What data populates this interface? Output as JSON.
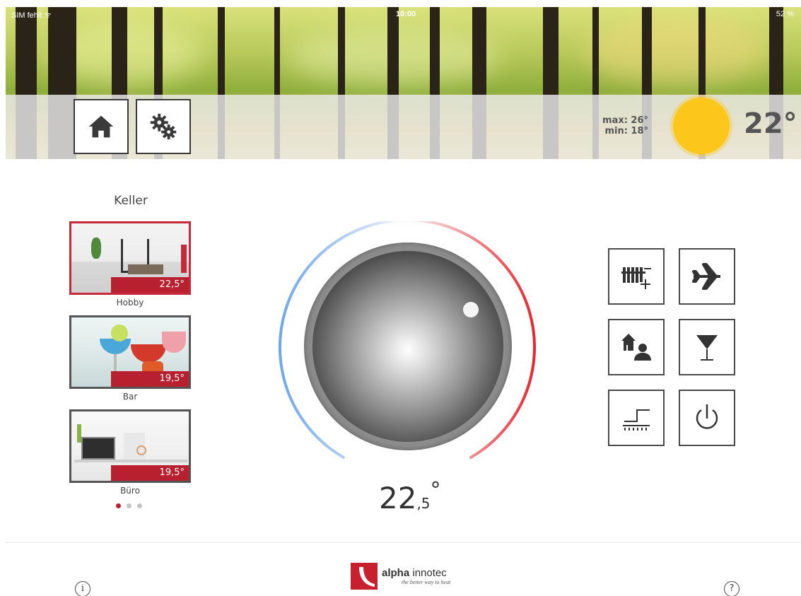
{
  "statusbar": {
    "carrier": "SIM fehlt ᯤ",
    "clock": "10:00",
    "battery": "52 %"
  },
  "header": {
    "home_icon": "home-icon",
    "settings_icon": "gears-icon",
    "weather": {
      "max": "max: 26°",
      "min": "min: 18°",
      "icon": "sun-icon",
      "outside_temp": "22°",
      "sun_color": "#fcc71a"
    }
  },
  "rooms": {
    "floor": "Keller",
    "items": [
      {
        "name": "Hobby",
        "temp": "22,5°",
        "active": true
      },
      {
        "name": "Bar",
        "temp": "19,5°",
        "active": false
      },
      {
        "name": "Büro",
        "temp": "19,5°",
        "active": false
      }
    ],
    "page_count": 3,
    "current_page": 1
  },
  "dial": {
    "set_temp_int": "22",
    "set_temp_dec": ",5",
    "set_temp_deg": "°",
    "cold_color": "#6fa7e8",
    "hot_color": "#e8262f"
  },
  "functions": [
    {
      "name": "radiator-boost",
      "icon": "radiator-plus-icon"
    },
    {
      "name": "holiday",
      "icon": "airplane-icon"
    },
    {
      "name": "away-presence",
      "icon": "house-person-icon"
    },
    {
      "name": "party",
      "icon": "cocktail-icon"
    },
    {
      "name": "floor-heating",
      "icon": "floor-heating-icon"
    },
    {
      "name": "power",
      "icon": "power-icon"
    }
  ],
  "footer": {
    "info": "i",
    "help": "?",
    "logo_brand_bold": "alpha",
    "logo_brand": " innotec",
    "logo_slogan": "the better way to heat",
    "brand_color": "#c8202f"
  }
}
